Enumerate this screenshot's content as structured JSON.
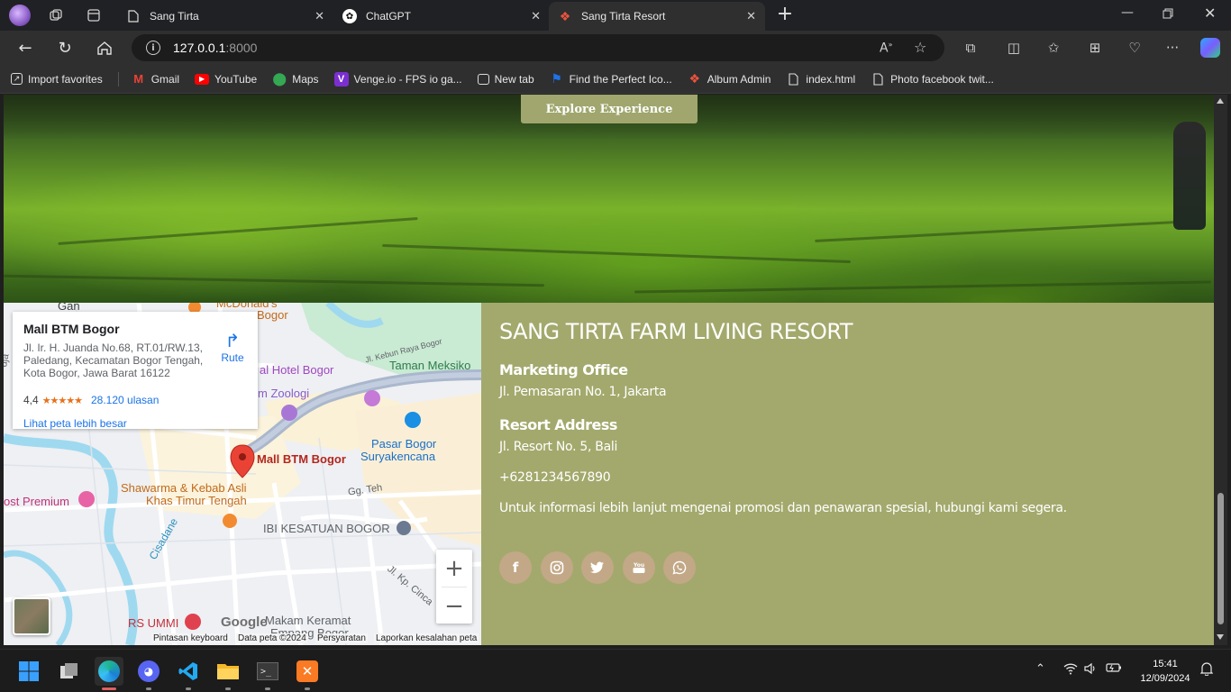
{
  "browser": {
    "tabs": [
      {
        "label": "Sang Tirta",
        "active": false
      },
      {
        "label": "ChatGPT",
        "active": false
      },
      {
        "label": "Sang Tirta Resort",
        "active": true
      }
    ],
    "url_host": "127.0.0.1",
    "url_port": ":8000",
    "bookmarks": [
      {
        "label": "Import favorites",
        "icon": "import-icon"
      },
      {
        "label": "Gmail",
        "icon": "gmail-icon"
      },
      {
        "label": "YouTube",
        "icon": "youtube-icon"
      },
      {
        "label": "Maps",
        "icon": "maps-icon"
      },
      {
        "label": "Venge.io - FPS io ga...",
        "icon": "venge-icon"
      },
      {
        "label": "New tab",
        "icon": "newtab-icon"
      },
      {
        "label": "Find the Perfect Ico...",
        "icon": "flag-icon"
      },
      {
        "label": "Album Admin",
        "icon": "laravel-icon"
      },
      {
        "label": "index.html",
        "icon": "file-icon"
      },
      {
        "label": "Photo facebook twit...",
        "icon": "file-icon"
      }
    ]
  },
  "hero": {
    "explore_button": "Explore Experience"
  },
  "map": {
    "place_name": "Mall BTM Bogor",
    "address": "Jl. Ir. H. Juanda No.68, RT.01/RW.13, Paledang, Kecamatan Bogor Tengah, Kota Bogor, Jawa Barat 16122",
    "rating": "4,4",
    "stars": "★★★★★",
    "reviews": "28.120 ulasan",
    "larger_map_link": "Lihat peta lebih besar",
    "route_label": "Rute",
    "labels": {
      "mcdonalds": "McDonald's",
      "bogor": "Bogor",
      "hotel_bogor": "al Hotel Bogor",
      "taman_meksiko": "Taman Meksiko",
      "jl_kebun_raya": "Jl. Kebun Raya Bogor",
      "zoologi": "m Zoologi",
      "pasar_bogor_1": "Pasar Bogor",
      "pasar_bogor_2": "Suryakencana",
      "mall_pin": "Mall BTM Bogor",
      "shawarma_1": "Shawarma & Kebab Asli",
      "shawarma_2": "Khas Timur Tengah",
      "ost_premium": "ost Premium",
      "gg_teh": "Gg. Teh",
      "ibi": "IBI KESATUAN BOGOR",
      "cisadane": "Cisadane",
      "jl_kp_cinca": "Jl. Kp. Cinca",
      "rs_ummi": "RS UMMI",
      "makam_1": "Makam Keramat",
      "makam_2": "Empang Bogor",
      "dja": "dja",
      "gan": "Gan"
    },
    "google_logo": "Google",
    "footer": [
      "Pintasan keyboard",
      "Data peta ©2024",
      "Persyaratan",
      "Laporkan kesalahan peta"
    ]
  },
  "contact": {
    "title": "SANG TIRTA FARM LIVING RESORT",
    "marketing_heading": "Marketing Office",
    "marketing_address": "Jl. Pemasaran No. 1, Jakarta",
    "resort_heading": "Resort Address",
    "resort_address": "Jl. Resort No. 5, Bali",
    "phone": "+6281234567890",
    "info": "Untuk informasi lebih lanjut mengenai promosi dan penawaran spesial, hubungi kami segera.",
    "social": [
      "facebook-icon",
      "instagram-icon",
      "twitter-icon",
      "youtube-icon",
      "whatsapp-icon"
    ]
  },
  "taskbar": {
    "time": "15:41",
    "date": "12/09/2024"
  },
  "colors": {
    "accent_olive": "#a3a96c",
    "social_bg": "#c2a887",
    "map_link": "#1a73e8",
    "pin_red": "#ea4335"
  }
}
